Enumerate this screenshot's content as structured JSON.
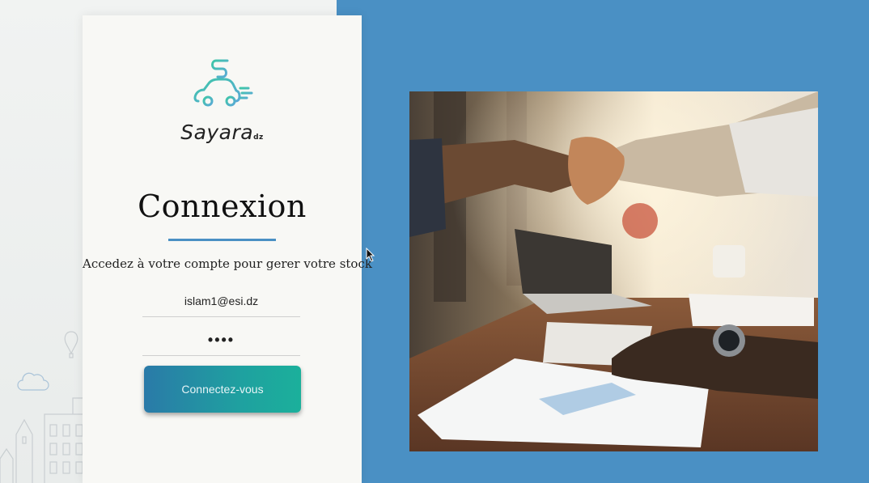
{
  "brand": {
    "name": "Sayara",
    "suffix": "dz"
  },
  "login": {
    "title": "Connexion",
    "subtitle": "Accedez à votre compte pour gerer votre stock",
    "email_value": "islam1@esi.dz",
    "password_masked": "••••",
    "submit_label": "Connectez-vous"
  },
  "colors": {
    "accent_blue": "#4a90c4",
    "button_start": "#2a7aa8",
    "button_end": "#1bb09b",
    "logo_teal": "#3fbfae"
  },
  "icons": [
    "car-logo-icon",
    "cloud-icon",
    "balloon-icon",
    "mouse-cursor-icon"
  ]
}
